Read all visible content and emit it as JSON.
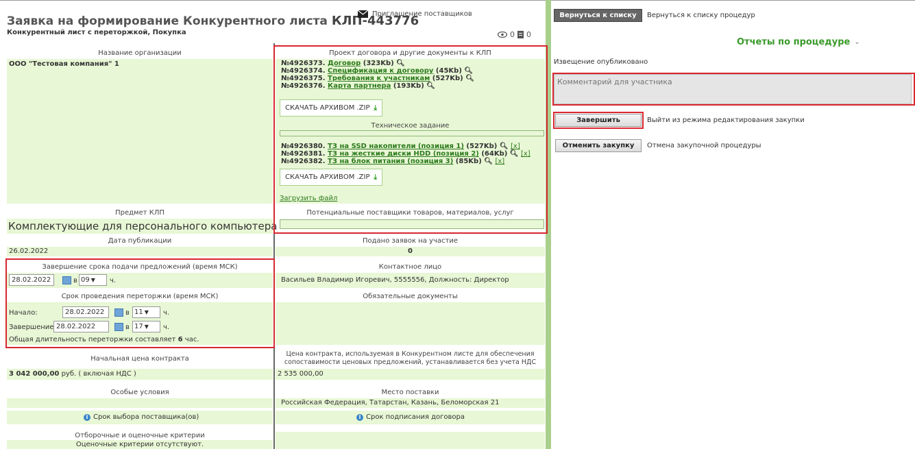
{
  "header": {
    "title_prefix": "Заявка на формирование Конкурентного листа ",
    "title_id": "КЛП-443776",
    "subtitle": "Конкурентный лист с переторжкой, Покупка",
    "invite_label": "Приглашение поставщиков",
    "views_count": "0",
    "docs_count": "0"
  },
  "org": {
    "label": "Название организации",
    "value": "ООО \"Тестовая компания\" 1"
  },
  "docs": {
    "label": "Проект договора и другие документы к КЛП",
    "items": [
      {
        "num": "№4926373. ",
        "name": "Договор",
        "size": " (323Kb)"
      },
      {
        "num": "№4926374. ",
        "name": "Спецификация к договору",
        "size": " (45Kb)"
      },
      {
        "num": "№4926375. ",
        "name": "Требования к участникам",
        "size": " (527Kb)"
      },
      {
        "num": "№4926376. ",
        "name": "Карта партнера",
        "size": " (193Kb)"
      }
    ],
    "zip_label": "СКАЧАТЬ АРХИВОМ .ZIP",
    "tech_label": "Техническое задание",
    "tech_items": [
      {
        "num": "№4926380. ",
        "name": "ТЗ на SSD накопители (позиция 1)",
        "size": " (527Kb)",
        "x": "[x]"
      },
      {
        "num": "№4926381. ",
        "name": "ТЗ на жесткие диски HDD (позиция 2)",
        "size": " (64Kb)",
        "x": "[x]"
      },
      {
        "num": "№4926382. ",
        "name": "ТЗ на блок питания (позиция 3)",
        "size": " (85Kb)",
        "x": "[x]"
      }
    ],
    "zip2_label": "СКАЧАТЬ АРХИВОМ .ZIP",
    "upload_label": "Загрузить файл",
    "suppliers_label": "Потенциальные поставщики товаров, материалов, услуг"
  },
  "subject": {
    "label": "Предмет КЛП",
    "value": "Комплектующие для персонального компьютера"
  },
  "pubdate": {
    "label": "Дата публикации",
    "value": "26.02.2022"
  },
  "applications": {
    "label": "Подано заявок на участие",
    "value": "0"
  },
  "deadline": {
    "label": "Завершение срока подачи предложений (время МСК)",
    "date": "28.02.2022",
    "in": "в",
    "hour": "09",
    "h": "ч."
  },
  "contact": {
    "label": "Контактное лицо",
    "value": "Васильев Владимир Игоревич, 5555556, Должность: Директор"
  },
  "rebid": {
    "label": "Срок проведения переторжки (время МСК)",
    "start_label": "Начало:",
    "start_date": "28.02.2022",
    "start_hour": "11",
    "end_label": "Завершение:",
    "end_date": "28.02.2022",
    "end_hour": "17",
    "in": "в",
    "h": "ч.",
    "duration_prefix": "Общая длительность переторжки составляет ",
    "duration_value": "6",
    "duration_suffix": " час."
  },
  "required_docs": {
    "label": "Обязательные документы"
  },
  "start_price": {
    "label": "Начальная цена контракта",
    "amount": "3 042 000,00",
    "suffix": " руб. ( включая НДС )"
  },
  "contract_price": {
    "label": "Цена контракта, используемая в Конкурентном листе для обеспечения сопоставимости ценовых предложений, устанавливается без учета НДС",
    "value": "2 535 000,00"
  },
  "special": {
    "label": "Особые условия"
  },
  "delivery": {
    "label": "Место поставки",
    "value": "Российская Федерация, Татарстан, Казань, Беломорская 21"
  },
  "supplier_term": {
    "label": "Срок выбора поставщика(ов)"
  },
  "sign_term": {
    "label": "Срок подписания договора"
  },
  "criteria": {
    "label": "Отборочные и оценочные критерии",
    "value": "Оценочные критерии отсутствуют."
  },
  "right": {
    "back_button": "Вернуться к списку",
    "back_text": "Вернуться к списку процедур",
    "reports": "Отчеты по процедуре",
    "notice": "Извещение опубликовано",
    "comment_placeholder": "Комментарий для участника",
    "finish_button": "Завершить",
    "finish_text": "Выйти из режима редактирования закупки",
    "cancel_button": "Отменить закупку",
    "cancel_text": "Отмена закупочной процедуры"
  }
}
